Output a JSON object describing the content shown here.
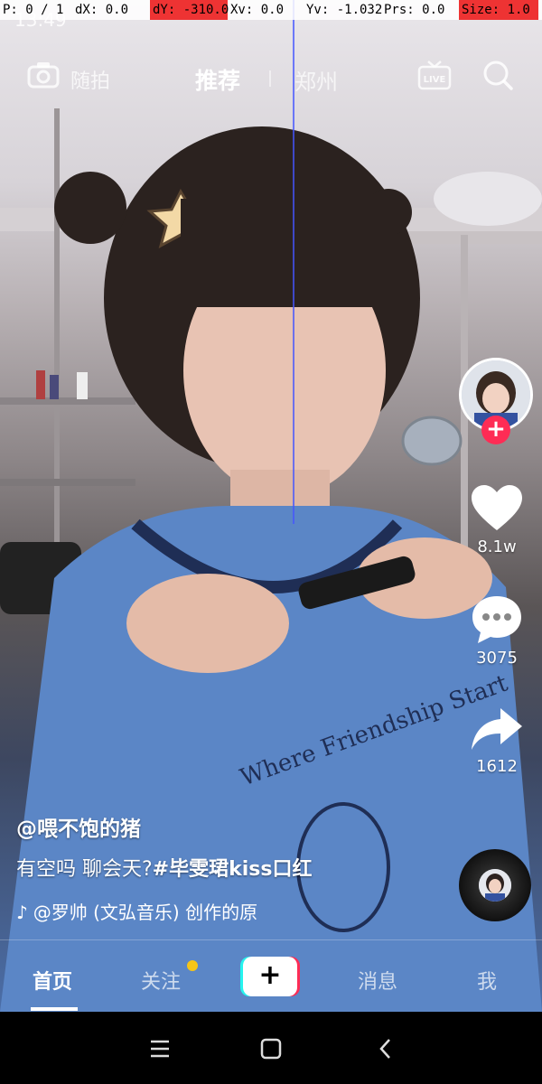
{
  "debug": {
    "pointer": "P: 0 / 1",
    "dx": "dX: 0.0",
    "dy": "dY: -310.0",
    "xv": "Xv: 0.0",
    "yv": "Yv: -1.032",
    "prs": "Prs: 0.0",
    "size": "Size: 1.0"
  },
  "status": {
    "time": "13:49"
  },
  "topnav": {
    "camera_icon": "camera-icon",
    "suipai": "随拍",
    "recommend": "推荐",
    "city": "郑州",
    "live": "LIVE",
    "search_icon": "search-icon"
  },
  "actions": {
    "likes": "8.1w",
    "comments": "3075",
    "shares": "1612"
  },
  "caption": {
    "author": "@喂不饱的猪",
    "text": "有空吗 聊会天?",
    "hashtag": "#毕雯珺kiss口红",
    "music": "@罗帅 (文弘音乐) 创作的原"
  },
  "tabs": {
    "home": "首页",
    "follow": "关注",
    "create": "+",
    "messages": "消息",
    "me": "我"
  },
  "colors": {
    "accent": "#fe2c55",
    "cyan": "#25f4ee",
    "dot": "#f5c518"
  }
}
